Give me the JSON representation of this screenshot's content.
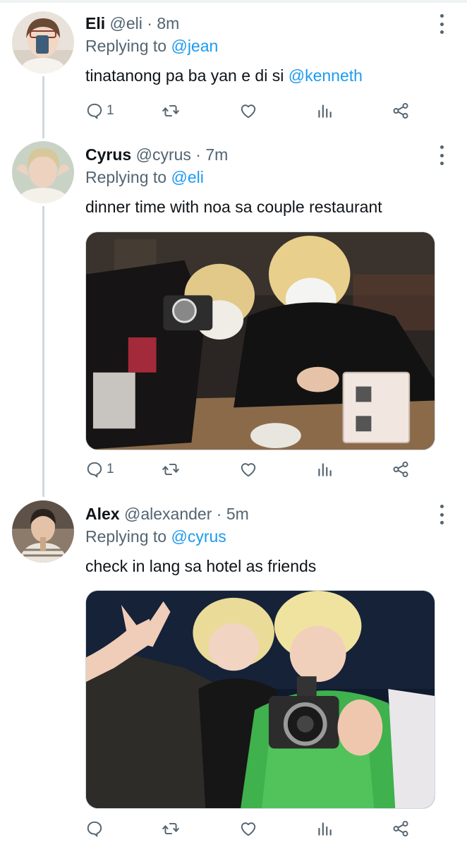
{
  "colors": {
    "accent": "#1d9bf0",
    "secondary_text": "#536471",
    "thread_line": "#cfd9de"
  },
  "tweets": [
    {
      "name": "Eli",
      "handle": "@eli",
      "separator": "·",
      "time": "8m",
      "replying_prefix": "Replying to",
      "replying_to": "@jean",
      "text": "tinatanong pa ba yan e di si ",
      "text_mention": "@kenneth",
      "reply_count": "1",
      "icons": [
        "reply-icon",
        "retweet-icon",
        "like-icon",
        "analytics-icon",
        "share-icon"
      ]
    },
    {
      "name": "Cyrus",
      "handle": "@cyrus",
      "separator": "·",
      "time": "7m",
      "replying_prefix": "Replying to",
      "replying_to": "@eli",
      "text": "dinner time with noa sa couple restaurant",
      "text_mention": "",
      "reply_count": "1",
      "icons": [
        "reply-icon",
        "retweet-icon",
        "like-icon",
        "analytics-icon",
        "share-icon"
      ]
    },
    {
      "name": "Alex",
      "handle": "@alexander",
      "separator": "·",
      "time": "5m",
      "replying_prefix": "Replying to",
      "replying_to": "@cyrus",
      "text": "check in lang sa hotel as friends",
      "text_mention": "",
      "reply_count": "",
      "icons": [
        "reply-icon",
        "retweet-icon",
        "like-icon",
        "analytics-icon",
        "share-icon"
      ]
    }
  ]
}
